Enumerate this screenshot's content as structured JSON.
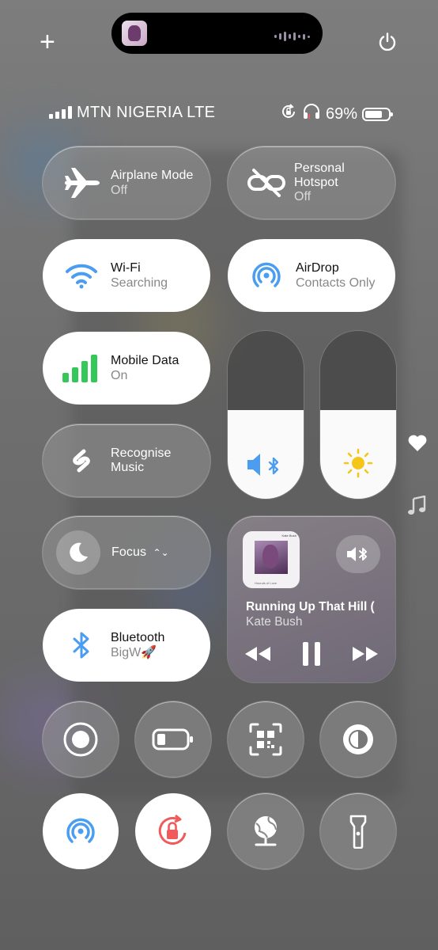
{
  "status_bar": {
    "carrier": "MTN NIGERIA LTE",
    "battery_percent": "69%",
    "signal_bars": 4
  },
  "now_playing_island": {
    "artwork": "album-art"
  },
  "tiles": {
    "airplane": {
      "title": "Airplane Mode",
      "state": "Off"
    },
    "hotspot": {
      "title_line1": "Personal",
      "title_line2": "Hotspot",
      "state": "Off"
    },
    "wifi": {
      "title": "Wi-Fi",
      "state": "Searching"
    },
    "airdrop": {
      "title": "AirDrop",
      "state": "Contacts Only"
    },
    "mobile_data": {
      "title": "Mobile Data",
      "state": "On"
    },
    "shazam": {
      "title_line1": "Recognise",
      "title_line2": "Music"
    },
    "focus": {
      "title": "Focus"
    },
    "bluetooth": {
      "title": "Bluetooth",
      "device": "BigW🚀"
    }
  },
  "sliders": {
    "volume": {
      "level": 0.53,
      "icon": "speaker-bluetooth-icon"
    },
    "brightness": {
      "level": 0.53,
      "icon": "sun-icon"
    }
  },
  "now_playing": {
    "song": "Running Up That Hill (",
    "artist": "Kate Bush",
    "cover_title": "Kate Bush",
    "cover_subtitle": "Hounds of Love"
  },
  "colors": {
    "accent_blue": "#4a9df0",
    "green": "#34c759",
    "red": "#f05a5a"
  }
}
